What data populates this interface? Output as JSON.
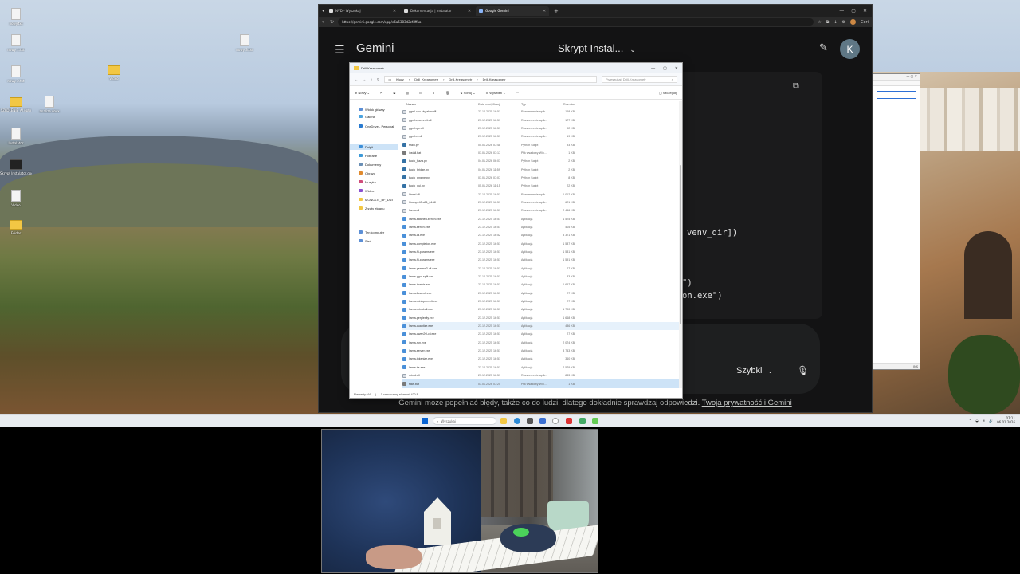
{
  "desktop": {
    "icons": [
      {
        "label": "nowy.txt"
      },
      {
        "label": "nowy 1.txt"
      },
      {
        "label": "nowy 2.txt"
      },
      {
        "label": "SZKOLENIE_AI.pptx"
      },
      {
        "label": "analiza.docx"
      },
      {
        "label": "Instalator"
      },
      {
        "label": "Skrypt Instalator.docx"
      },
      {
        "label": "Video"
      },
      {
        "label": "nowy 3.txt"
      },
      {
        "label": "Folder"
      },
      {
        "label": "notatka.txt"
      },
      {
        "label": "projekt.docx"
      }
    ]
  },
  "browser": {
    "tabs": [
      {
        "label": "NVD - Wyszukaj"
      },
      {
        "label": "Dokumentacja | Instalator"
      },
      {
        "label": "Google Gemini"
      }
    ],
    "url": "https://gemini.google.com/app/e6a5383d2cfdffaa",
    "profile_label": "Cori"
  },
  "gemini": {
    "app_title": "Gemini",
    "chat_title": "Skrypt Instal...",
    "avatar_letter": "K",
    "code_lines": [
      "venv_dir])",
      "\")",
      "on.exe\")"
    ],
    "speed_label": "Szybki",
    "disclaimer_text": "Gemini może popełniać błędy, także co do ludzi, dlatego dokładnie sprawdzaj odpowiedzi.",
    "privacy_link": "Twoja prywatność i Gemini"
  },
  "explorer": {
    "window_title": "Drill-Kreasometr",
    "breadcrumb": [
      "Klucz",
      "Drill_Kreasometr",
      "Drill-Kreasometr",
      "Drill-Kreasometr"
    ],
    "search_placeholder": "Przeszukaj: Drill-Kreasometr",
    "toolbar": {
      "new": "Nowy",
      "sort": "Sortuj",
      "view": "Wyświetl",
      "details": "Szczegóły"
    },
    "nav": [
      "Widok główny",
      "Galeria",
      "OneDrive - Personal",
      "Pulpit",
      "Pobrane",
      "Dokumenty",
      "Obrazy",
      "Muzyka",
      "Wideo",
      "MONOLIT_BF_DNT",
      "Zrzuty ekranu",
      "Ten komputer",
      "Sieć"
    ],
    "columns": {
      "name": "Nazwa",
      "date": "Data modyfikacji",
      "type": "Typ",
      "size": "Rozmiar"
    },
    "files": [
      {
        "name": "ggml-cpu-skylakex.dll",
        "date": "23.12.2025 16:51",
        "type": "Rozszerzenie aplik...",
        "size": "168 KB",
        "kind": "dll"
      },
      {
        "name": "ggml-cpu-zen4.dll",
        "date": "23.12.2025 16:51",
        "type": "Rozszerzenie aplik...",
        "size": "177 KB",
        "kind": "dll"
      },
      {
        "name": "ggml-rpc.dll",
        "date": "23.12.2025 16:51",
        "type": "Rozszerzenie aplik...",
        "size": "92 KB",
        "kind": "dll"
      },
      {
        "name": "ggml-vk.dll",
        "date": "23.12.2025 16:51",
        "type": "Rozszerzenie aplik...",
        "size": "19 KB",
        "kind": "dll"
      },
      {
        "name": "Main.py",
        "date": "05.01.2026 07:48",
        "type": "Python Script",
        "size": "93 KB",
        "kind": "py"
      },
      {
        "name": "install.bat",
        "date": "03.01.2026 07:17",
        "type": "Plik wsadowy Win...",
        "size": "1 KB",
        "kind": "bat"
      },
      {
        "name": "kucik_baza.py",
        "date": "04.01.2026 06:03",
        "type": "Python Script",
        "size": "2 KB",
        "kind": "py"
      },
      {
        "name": "kucik_bridge.py",
        "date": "04.01.2026 11:59",
        "type": "Python Script",
        "size": "2 KB",
        "kind": "py"
      },
      {
        "name": "kucik_engine.py",
        "date": "03.01.2026 07:07",
        "type": "Python Script",
        "size": "8 KB",
        "kind": "py"
      },
      {
        "name": "kucik_gui.py",
        "date": "05.01.2026 11:15",
        "type": "Python Script",
        "size": "22 KB",
        "kind": "py"
      },
      {
        "name": "libcurl.dll",
        "date": "23.12.2025 16:51",
        "type": "Rozszerzenie aplik...",
        "size": "1 012 KB",
        "kind": "dll"
      },
      {
        "name": "libomp140.x86_64.dll",
        "date": "23.12.2025 16:51",
        "type": "Rozszerzenie aplik...",
        "size": "621 KB",
        "kind": "dll"
      },
      {
        "name": "llama.dll",
        "date": "23.12.2025 16:51",
        "type": "Rozszerzenie aplik...",
        "size": "2 466 KB",
        "kind": "dll"
      },
      {
        "name": "llama-batched-bench.exe",
        "date": "23.12.2025 16:51",
        "type": "Aplikacja",
        "size": "1 575 KB",
        "kind": "exe"
      },
      {
        "name": "llama-bench.exe",
        "date": "23.12.2025 16:51",
        "type": "Aplikacja",
        "size": "405 KB",
        "kind": "exe"
      },
      {
        "name": "llama-cli.exe",
        "date": "23.12.2025 16:52",
        "type": "Aplikacja",
        "size": "3 371 KB",
        "kind": "exe"
      },
      {
        "name": "llama-completion.exe",
        "date": "23.12.2025 16:51",
        "type": "Aplikacja",
        "size": "1 587 KB",
        "kind": "exe"
      },
      {
        "name": "llama-fit-params.exe",
        "date": "23.12.2025 16:51",
        "type": "Aplikacja",
        "size": "1 531 KB",
        "kind": "exe"
      },
      {
        "name": "llama-fit-params.exe",
        "date": "23.12.2025 16:51",
        "type": "Aplikacja",
        "size": "1 591 KB",
        "kind": "exe"
      },
      {
        "name": "llama-gemma3-cli.exe",
        "date": "23.12.2025 16:51",
        "type": "Aplikacja",
        "size": "27 KB",
        "kind": "exe"
      },
      {
        "name": "llama-gguf-split.exe",
        "date": "23.12.2025 16:51",
        "type": "Aplikacja",
        "size": "33 KB",
        "kind": "exe"
      },
      {
        "name": "llama-imatrix.exe",
        "date": "23.12.2025 16:51",
        "type": "Aplikacja",
        "size": "1 657 KB",
        "kind": "exe"
      },
      {
        "name": "llama-llava-cli.exe",
        "date": "23.12.2025 16:51",
        "type": "Aplikacja",
        "size": "27 KB",
        "kind": "exe"
      },
      {
        "name": "llama-minicpmv-cli.exe",
        "date": "23.12.2025 16:51",
        "type": "Aplikacja",
        "size": "27 KB",
        "kind": "exe"
      },
      {
        "name": "llama-mtmd-cli.exe",
        "date": "23.12.2025 16:51",
        "type": "Aplikacja",
        "size": "1 700 KB",
        "kind": "exe"
      },
      {
        "name": "llama-perplexity.exe",
        "date": "23.12.2025 16:51",
        "type": "Aplikacja",
        "size": "1 668 KB",
        "kind": "exe"
      },
      {
        "name": "llama-quantize.exe",
        "date": "23.12.2025 16:51",
        "type": "Aplikacja",
        "size": "486 KB",
        "kind": "exe"
      },
      {
        "name": "llama-qwen2vl-cli.exe",
        "date": "23.12.2025 16:51",
        "type": "Aplikacja",
        "size": "27 KB",
        "kind": "exe"
      },
      {
        "name": "llama-run.exe",
        "date": "23.12.2025 16:51",
        "type": "Aplikacja",
        "size": "2 074 KB",
        "kind": "exe"
      },
      {
        "name": "llama-server.exe",
        "date": "23.12.2025 16:51",
        "type": "Aplikacja",
        "size": "3 743 KB",
        "kind": "exe"
      },
      {
        "name": "llama-tokenize.exe",
        "date": "23.12.2025 16:51",
        "type": "Aplikacja",
        "size": "360 KB",
        "kind": "exe"
      },
      {
        "name": "llama-tts.exe",
        "date": "23.12.2025 16:51",
        "type": "Aplikacja",
        "size": "2 579 KB",
        "kind": "exe"
      },
      {
        "name": "mtmd.dll",
        "date": "23.12.2025 16:51",
        "type": "Rozszerzenie aplik...",
        "size": "883 KB",
        "kind": "dll"
      },
      {
        "name": "start.bat",
        "date": "03.01.2026 07:20",
        "type": "Plik wsadowy Win...",
        "size": "1 KB",
        "kind": "bat"
      }
    ],
    "hover_index": 26,
    "selected_index": 33,
    "status": {
      "count": "Elementy: 44",
      "selection": "1 zaznaczony element: 420 B"
    }
  },
  "notepad": {
    "status": "INS"
  },
  "taskbar": {
    "search_placeholder": "Wyszukaj",
    "time": "07:11",
    "date": "06.01.2026"
  }
}
